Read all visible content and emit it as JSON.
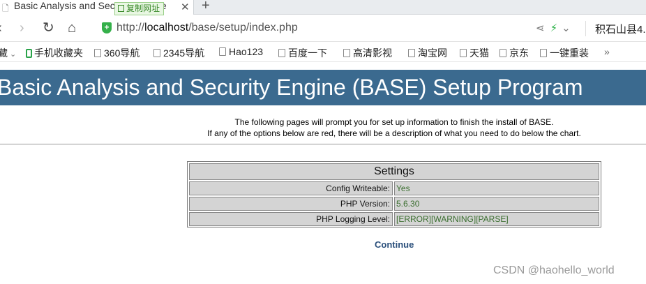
{
  "browser": {
    "tab": {
      "title": "Basic Analysis and Security Engine",
      "copy_url_label": "复制网址"
    },
    "address": {
      "scheme": "http://",
      "host": "localhost",
      "path": "/base/setup/index.php"
    },
    "weather_text": "积石山县4."
  },
  "bookmarks": [
    {
      "label": "藏",
      "icon": "none"
    },
    {
      "label": "手机收藏夹",
      "icon": "phone-icon"
    },
    {
      "label": "360导航",
      "icon": "page-icon"
    },
    {
      "label": "2345导航",
      "icon": "page-icon"
    },
    {
      "label": "Hao123",
      "icon": "page-icon"
    },
    {
      "label": "百度一下",
      "icon": "page-icon"
    },
    {
      "label": "高清影视",
      "icon": "page-icon"
    },
    {
      "label": "淘宝网",
      "icon": "page-icon"
    },
    {
      "label": "天猫",
      "icon": "page-icon"
    },
    {
      "label": "京东",
      "icon": "page-icon"
    },
    {
      "label": "一键重装",
      "icon": "page-icon"
    }
  ],
  "bookmarks_more": "»",
  "page": {
    "banner_title": "Basic Analysis and Security Engine (BASE) Setup Program",
    "intro_line1": "The following pages will prompt you for set up information to finish the install of BASE.",
    "intro_line2": "If any of the options below are red, there will be a description of what you need to do below the chart.",
    "settings": {
      "title": "Settings",
      "rows": [
        {
          "label": "Config Writeable:",
          "value": "Yes"
        },
        {
          "label": "PHP Version:",
          "value": "5.6.30"
        },
        {
          "label": "PHP Logging Level:",
          "value": "[ERROR][WARNING][PARSE]"
        }
      ]
    },
    "continue_label": "Continue"
  },
  "watermark": "CSDN @haohello_world",
  "colors": {
    "banner": "#3b6a8f",
    "value_text": "#3a6e2f",
    "link": "#2a4f7b",
    "secure_shield": "#34b04a"
  }
}
